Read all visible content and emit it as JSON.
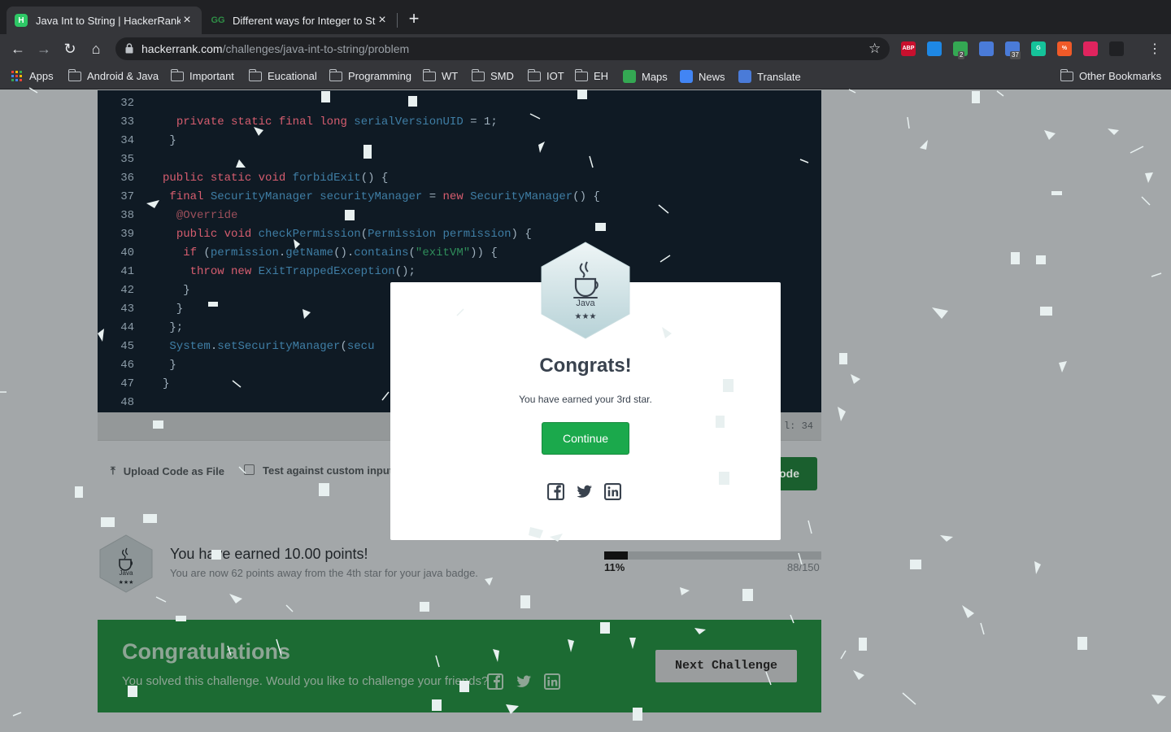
{
  "browser": {
    "tabs": [
      {
        "title": "Java Int to String | HackerRank",
        "favicon": "H"
      },
      {
        "title": "Different ways for Integer to St",
        "favicon": "GG"
      }
    ],
    "url_host": "hackerrank.com",
    "url_path": "/challenges/java-int-to-string/problem",
    "extensions": [
      {
        "icon": "adblock-icon",
        "label": "ABP",
        "color": "#c8102e"
      },
      {
        "icon": "extension-blue-icon",
        "label": "",
        "color": "#1e88e5"
      },
      {
        "icon": "check-extension-icon",
        "label": "",
        "color": "#34a853",
        "badge": "2"
      },
      {
        "icon": "translate-extension-icon",
        "label": "",
        "color": "#4a7bd8"
      },
      {
        "icon": "calendar-extension-icon",
        "label": "",
        "color": "#4a7bd8",
        "badge": "37"
      },
      {
        "icon": "grammarly-icon",
        "label": "G",
        "color": "#15c39a"
      },
      {
        "icon": "percent-extension-icon",
        "label": "%",
        "color": "#f05a28"
      },
      {
        "icon": "screenshot-extension-icon",
        "label": "",
        "color": "#e0245e"
      },
      {
        "icon": "profile-extension-icon",
        "label": "",
        "color": "#202124"
      }
    ],
    "bookmarks": [
      {
        "label": "Apps",
        "icon": "apps-icon"
      },
      {
        "label": "Android & Java",
        "icon": "folder-icon"
      },
      {
        "label": "Important",
        "icon": "folder-icon"
      },
      {
        "label": "Eucational",
        "icon": "folder-icon"
      },
      {
        "label": "Programming",
        "icon": "folder-icon"
      },
      {
        "label": "WT",
        "icon": "folder-icon"
      },
      {
        "label": "SMD",
        "icon": "folder-icon"
      },
      {
        "label": "IOT",
        "icon": "folder-icon"
      },
      {
        "label": "EH",
        "icon": "folder-icon"
      },
      {
        "label": "Maps",
        "icon": "maps-icon"
      },
      {
        "label": "News",
        "icon": "news-icon"
      },
      {
        "label": "Translate",
        "icon": "translate-icon"
      }
    ],
    "other_bookmarks": "Other Bookmarks"
  },
  "editor": {
    "lines": [
      {
        "n": "32",
        "code": ""
      },
      {
        "n": "33",
        "code": "  private static final long serialVersionUID = 1;"
      },
      {
        "n": "34",
        "code": " }"
      },
      {
        "n": "35",
        "code": ""
      },
      {
        "n": "36",
        "code": "public static void forbidExit() {"
      },
      {
        "n": "37",
        "code": " final SecurityManager securityManager = new SecurityManager() {"
      },
      {
        "n": "38",
        "code": "  @Override"
      },
      {
        "n": "39",
        "code": "  public void checkPermission(Permission permission) {"
      },
      {
        "n": "40",
        "code": "   if (permission.getName().contains(\"exitVM\")) {"
      },
      {
        "n": "41",
        "code": "    throw new ExitTrappedException();"
      },
      {
        "n": "42",
        "code": "   }"
      },
      {
        "n": "43",
        "code": "  }"
      },
      {
        "n": "44",
        "code": " };"
      },
      {
        "n": "45",
        "code": " System.setSecurityManager(secu"
      },
      {
        "n": "46",
        "code": " }"
      },
      {
        "n": "47",
        "code": "}"
      },
      {
        "n": "48",
        "code": ""
      }
    ],
    "cursor_position": "l: 34"
  },
  "actions": {
    "upload_label": "Upload Code as File",
    "custom_input_label": "Test against custom input",
    "submit_label": "ode"
  },
  "progress": {
    "badge_name": "Java",
    "earned_title": "You have earned 10.00 points!",
    "earned_sub": "You are now 62 points away from the 4th star for your java badge.",
    "percent_label": "11%",
    "percent_value": 0.11,
    "points_label": "88/150"
  },
  "banner": {
    "title": "Congratulations",
    "subtitle": "You solved this challenge. Would you like to challenge your friends?",
    "next_label": "Next Challenge"
  },
  "modal": {
    "badge_name": "Java",
    "stars": 3,
    "title": "Congrats!",
    "subtitle": "You have earned your 3rd star.",
    "continue_label": "Continue",
    "social": [
      "facebook-icon",
      "twitter-icon",
      "linkedin-icon"
    ]
  }
}
